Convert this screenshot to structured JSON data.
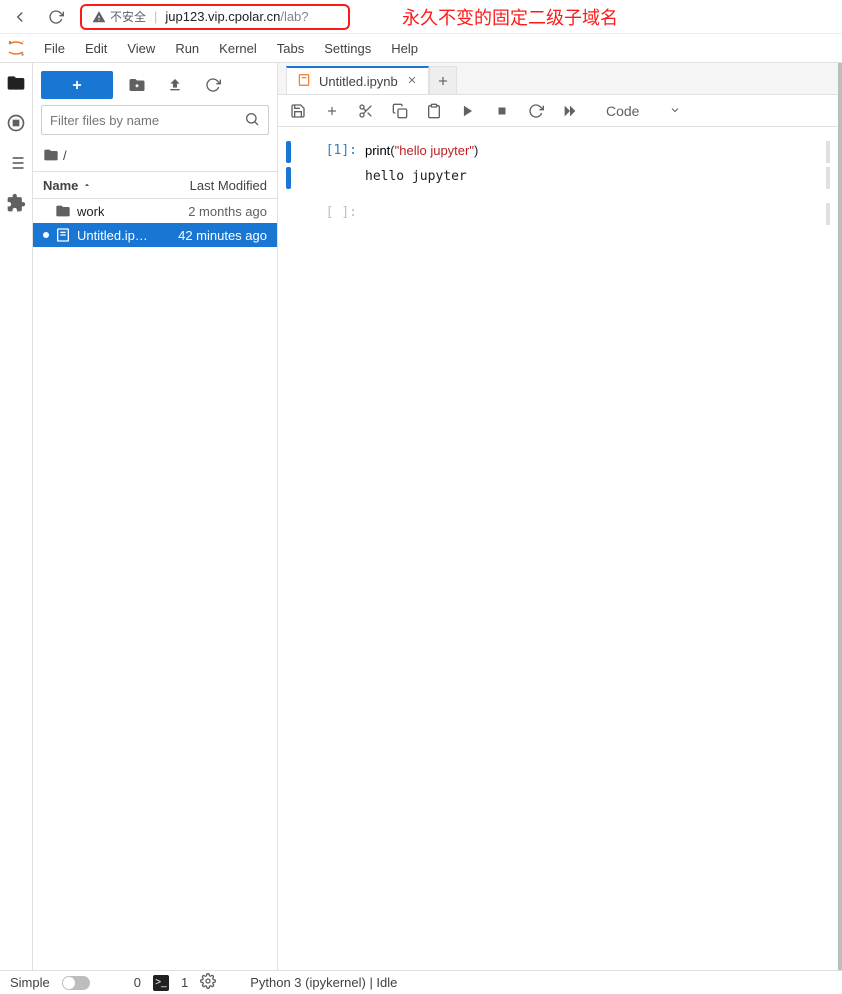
{
  "browser": {
    "insecure_label": "不安全",
    "url_host": "jup123.vip.cpolar.cn",
    "url_path": "/lab?",
    "annotation": "永久不变的固定二级子域名"
  },
  "menu": [
    "File",
    "Edit",
    "View",
    "Run",
    "Kernel",
    "Tabs",
    "Settings",
    "Help"
  ],
  "panel": {
    "filter_placeholder": "Filter files by name",
    "crumb_root": "/",
    "header_name": "Name",
    "header_modified": "Last Modified",
    "files": [
      {
        "type": "folder",
        "name": "work",
        "time": "2 months ago",
        "selected": false
      },
      {
        "type": "notebook",
        "name": "Untitled.ip…",
        "time": "42 minutes ago",
        "selected": true
      }
    ]
  },
  "tab": {
    "title": "Untitled.ipynb"
  },
  "toolbar": {
    "cell_type": "Code"
  },
  "cells": {
    "in1_prompt": "[1]:",
    "in1_code_fn": "print",
    "in1_code_open": "(",
    "in1_code_str": "\"hello jupyter\"",
    "in1_code_close": ")",
    "out1_text": "hello jupyter",
    "empty_prompt": "[ ]:"
  },
  "status": {
    "simple": "Simple",
    "tabs": "0",
    "terms": "1",
    "kernel": "Python 3 (ipykernel) | Idle"
  }
}
